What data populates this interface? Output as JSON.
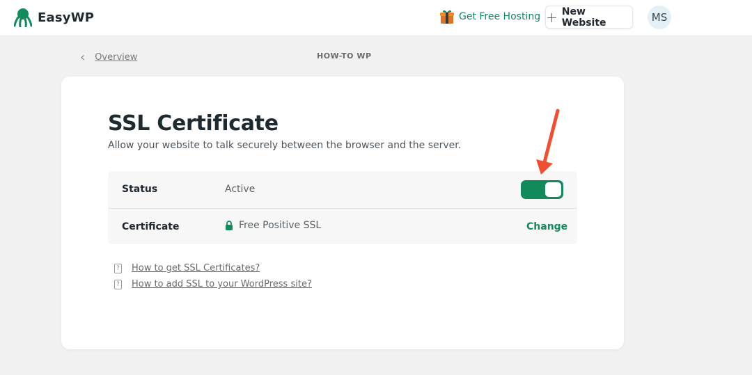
{
  "header": {
    "brand_name": "EasyWP",
    "free_hosting_label": "Get Free Hosting",
    "new_website_label": "New Website",
    "avatar_initials": "MS"
  },
  "breadcrumb": {
    "back_label": "Overview",
    "site_name": "HOW-TO WP"
  },
  "ssl": {
    "title": "SSL Certificate",
    "subtitle": "Allow your website to talk securely between the browser and the server.",
    "status_label": "Status",
    "status_value": "Active",
    "toggle_on": true,
    "certificate_label": "Certificate",
    "certificate_value": "Free Positive SSL",
    "change_label": "Change"
  },
  "help_links": [
    "How to get SSL Certificates?",
    "How to add SSL to your WordPress site?"
  ],
  "colors": {
    "accent": "#138a5c",
    "annotation_arrow": "#f0502f"
  }
}
